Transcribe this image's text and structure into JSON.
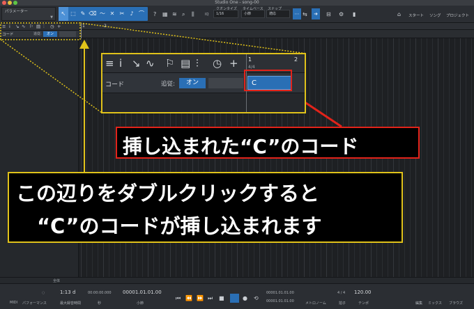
{
  "window": {
    "title": "Studio One - song-00"
  },
  "toolbar": {
    "param_label": "パラメーター",
    "quantize_label": "クオンタイズ",
    "quantize_value": "1/16",
    "timebase_label": "タイムベース",
    "timebase_value": "小節",
    "snap_label": "スナップ",
    "snap_value": "適応",
    "iq_label": "IQ",
    "start_label": "スタート",
    "song_label": "ソング",
    "project_label": "プロジェクト",
    "tool_icons": [
      "arrow-tool",
      "range-tool",
      "pencil-tool",
      "eraser-tool",
      "paint-tool",
      "mute-tool",
      "split-tool",
      "listen-tool",
      "bend-tool"
    ]
  },
  "chord_track": {
    "name": "コード",
    "follow_label": "追従:",
    "follow_value": "オン"
  },
  "ruler": {
    "bar1": "1",
    "bar2": "2",
    "time_signature": "4/4"
  },
  "chord_event": {
    "label": "C"
  },
  "captions": {
    "inserted_chord": "挿し込まれた“C”のコード",
    "double_click_line1": "この辺りをダブルクリックすると",
    "double_click_line2": "“C”のコードが挿し込まれます"
  },
  "scroll": {
    "zoom_label": "全体"
  },
  "transport": {
    "midi_label": "MIDI",
    "performance_label": "パフォーマンス",
    "time_display": "1:13 d",
    "max_record_label": "最大録音時間",
    "seconds_value": "00:00:00.000",
    "seconds_label": "秒",
    "bars_value": "00001.01.01.00",
    "bars_label": "小節",
    "loop_l": "00001.01.01.00",
    "loop_r": "00001.01.01.00",
    "metronome_label": "メトロノーム",
    "timesig_value": "4 / 4",
    "timesig_label": "拍子",
    "tempo_value": "120.00",
    "tempo_label": "テンポ",
    "edit_label": "編集",
    "mix_label": "ミックス",
    "browse_label": "ブラウズ"
  },
  "colors": {
    "accent_blue": "#2a6fb5",
    "highlight_red": "#e2231a",
    "callout_yellow": "#e0c21a"
  }
}
